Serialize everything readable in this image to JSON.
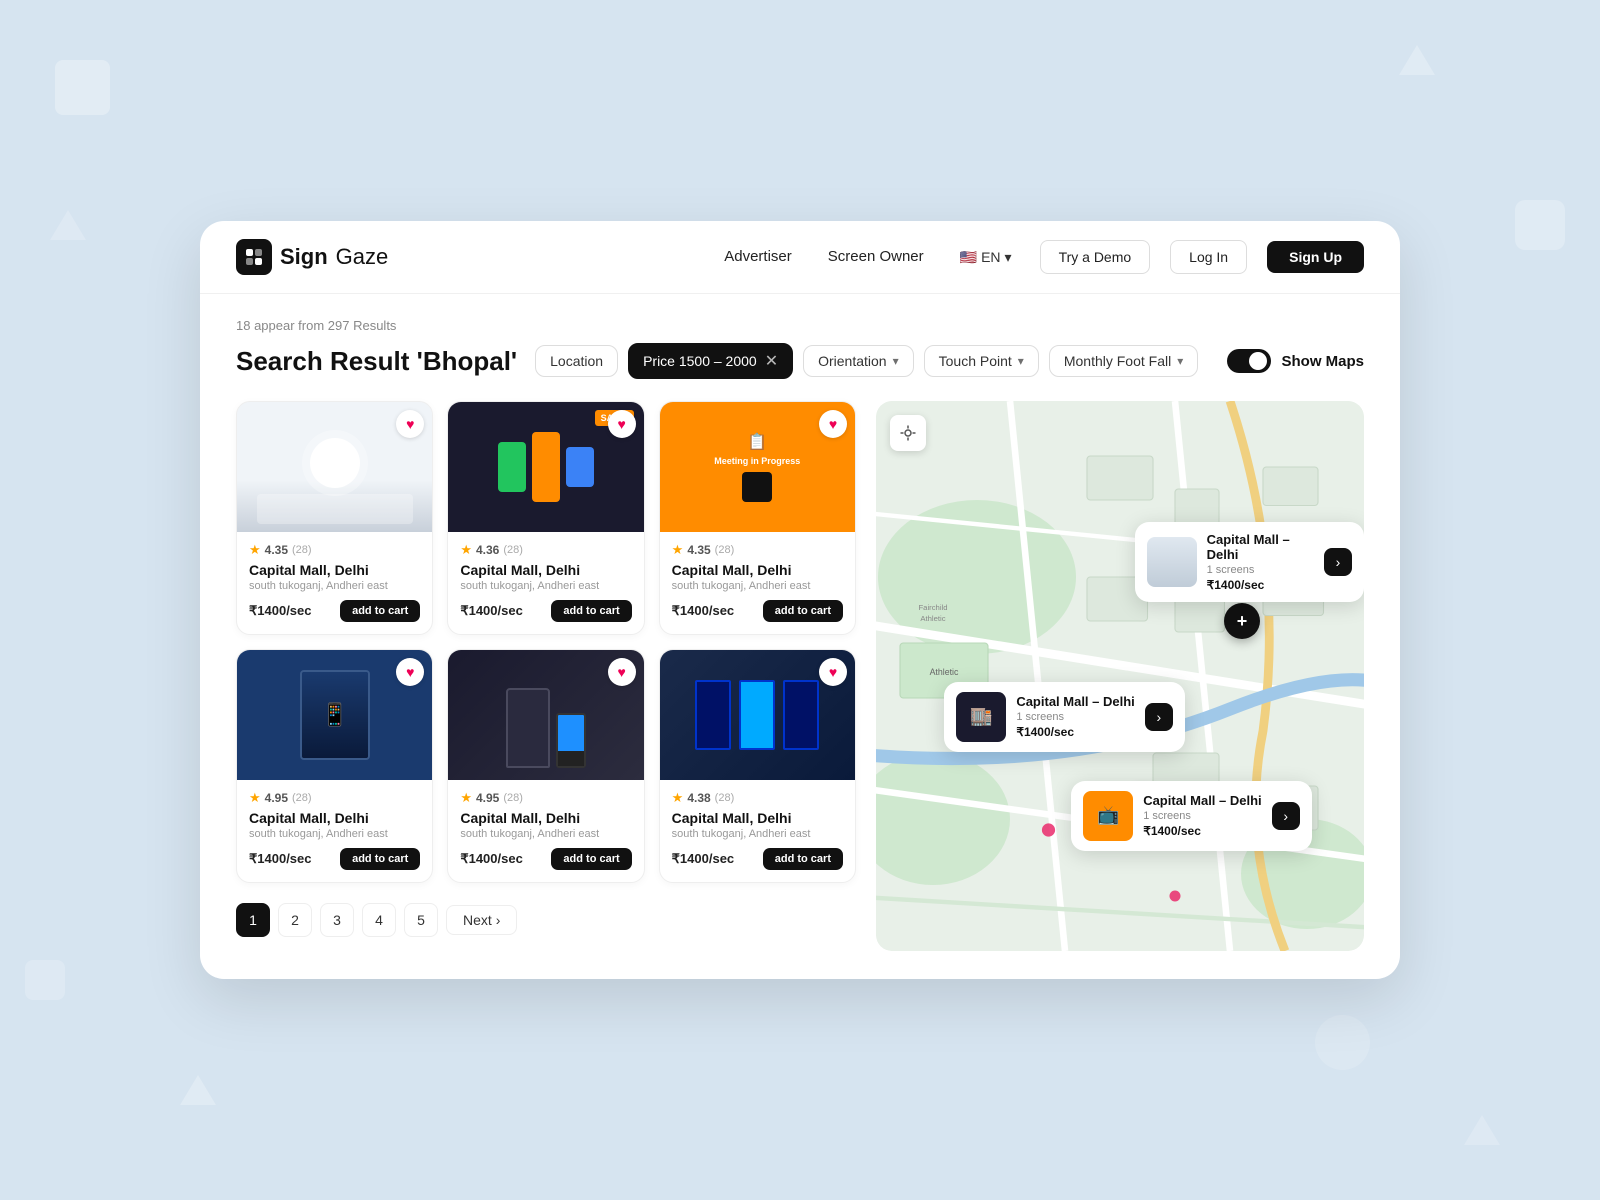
{
  "header": {
    "logo": {
      "sign": "Sign",
      "gaze": "Gaze"
    },
    "nav": {
      "advertiser": "Advertiser",
      "screenOwner": "Screen Owner"
    },
    "lang": {
      "label": "EN"
    },
    "buttons": {
      "tryDemo": "Try a Demo",
      "login": "Log In",
      "signup": "Sign Up"
    }
  },
  "search": {
    "resultsText": "18 appear from 297 Results",
    "titlePrefix": "Search Result",
    "titleQuery": "'Bhopal'"
  },
  "filters": {
    "location": {
      "label": "Location"
    },
    "price": {
      "label": "Price 1500 – 2000"
    },
    "orientation": {
      "label": "Orientation"
    },
    "touchPoint": {
      "label": "Touch Point"
    },
    "monthlyFootFall": {
      "label": "Monthly Foot Fall"
    },
    "showMaps": {
      "label": "Show Maps",
      "enabled": true
    }
  },
  "cards": [
    {
      "rating": "4.35",
      "ratingCount": "(28)",
      "name": "Capital Mall, Delhi",
      "location": "south tukoganj, Andheri east",
      "price": "₹1400/sec",
      "cartBtn": "add to cart"
    },
    {
      "rating": "4.36",
      "ratingCount": "(28)",
      "name": "Capital Mall, Delhi",
      "location": "south tukoganj, Andheri east",
      "price": "₹1400/sec",
      "cartBtn": "add to cart"
    },
    {
      "rating": "4.35",
      "ratingCount": "(28)",
      "name": "Capital Mall, Delhi",
      "location": "south tukoganj, Andheri east",
      "price": "₹1400/sec",
      "cartBtn": "add to cart"
    },
    {
      "rating": "4.95",
      "ratingCount": "(28)",
      "name": "Capital Mall, Delhi",
      "location": "south tukoganj, Andheri east",
      "price": "₹1400/sec",
      "cartBtn": "add to cart"
    },
    {
      "rating": "4.95",
      "ratingCount": "(28)",
      "name": "Capital Mall, Delhi",
      "location": "south tukoganj, Andheri east",
      "price": "₹1400/sec",
      "cartBtn": "add to cart"
    },
    {
      "rating": "4.38",
      "ratingCount": "(28)",
      "name": "Capital Mall, Delhi",
      "location": "south tukoganj, Andheri east",
      "price": "₹1400/sec",
      "cartBtn": "add to cart"
    }
  ],
  "pagination": {
    "pages": [
      "1",
      "2",
      "3",
      "4",
      "5"
    ],
    "nextLabel": "Next"
  },
  "mapPopups": [
    {
      "name": "Capital Mall – Delhi",
      "screens": "1 screens",
      "price": "₹1400/sec"
    },
    {
      "name": "Capital Mall – Delhi",
      "screens": "1 screens",
      "price": "₹1400/sec"
    },
    {
      "name": "Capital Mall – Delhi",
      "screens": "1 screens",
      "price": "₹1400/sec"
    }
  ]
}
